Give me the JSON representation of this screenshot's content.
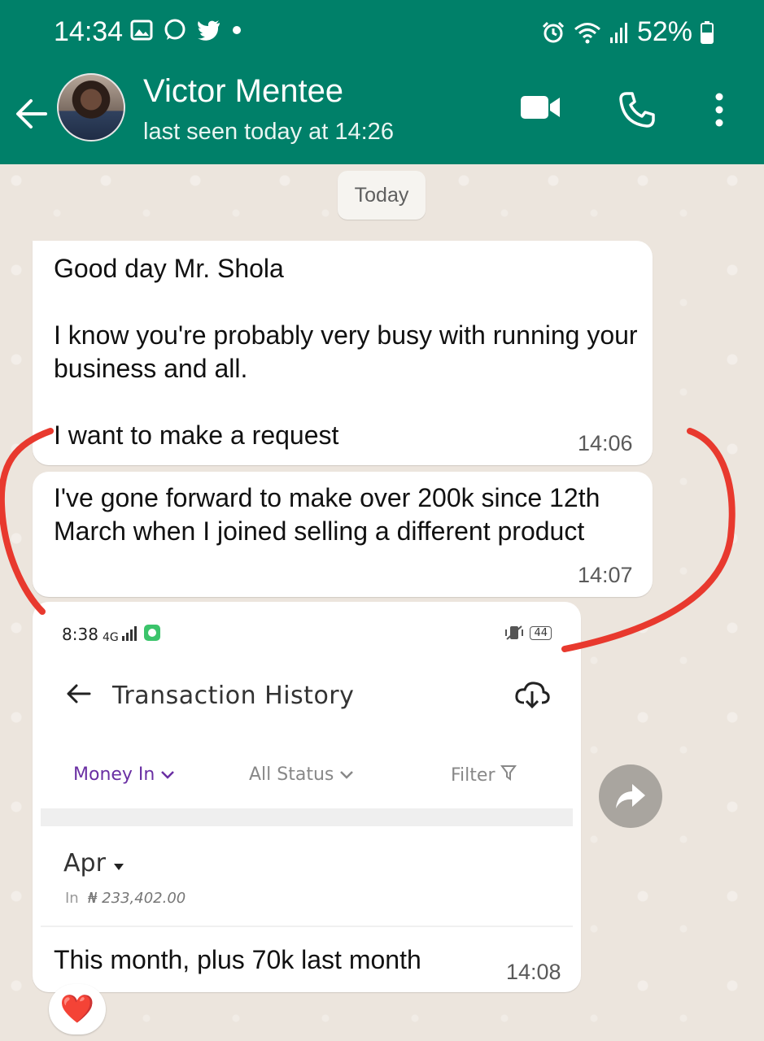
{
  "status_bar": {
    "time": "14:34",
    "battery": "52%",
    "left_icons": [
      "image-icon",
      "whatsapp-icon",
      "twitter-icon",
      "dot-icon"
    ],
    "right_icons": [
      "alarm-icon",
      "wifi-icon",
      "signal-icon",
      "battery-icon"
    ]
  },
  "header": {
    "name": "Victor Mentee",
    "last_seen": "last seen today at 14:26",
    "actions": [
      "video-call-icon",
      "phone-icon",
      "more-vertical-icon"
    ]
  },
  "chat": {
    "date_chip": "Today",
    "messages": [
      {
        "text": "Good day Mr. Shola\n\nI know you're probably very busy with running your business and all.\n\nI want to make a request",
        "time": "14:06"
      },
      {
        "text": "I've gone forward to make over 200k since 12th March when I joined selling a different product",
        "time": "14:07"
      },
      {
        "caption": "This month, plus 70k last month",
        "time": "14:08",
        "reaction": "❤️",
        "image": {
          "status_time": "8:38",
          "network": "4G",
          "battery": "44",
          "title": "Transaction History",
          "filters": {
            "money_in": "Money In",
            "status": "All Status",
            "filter": "Filter"
          },
          "month": "Apr",
          "in_label": "In",
          "in_value": "₦ 233,402.00"
        }
      }
    ]
  },
  "colors": {
    "header": "#008069",
    "chat_bg": "#ece5dd",
    "bubble": "#ffffff",
    "annotation": "#e8392e",
    "money_in": "#6a2fa3"
  }
}
